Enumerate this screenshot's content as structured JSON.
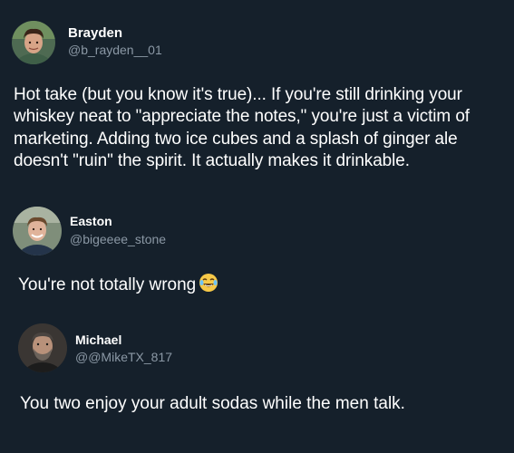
{
  "posts": [
    {
      "display_name": "Brayden",
      "handle": "@b_rayden__01",
      "text": "Hot take (but you know it's true)... If you're still drinking your whiskey neat to \"appreciate the notes,\" you're just a victim of marketing. Adding two ice cubes and a splash of ginger ale doesn't \"ruin\" the spirit. It actually makes it drinkable."
    },
    {
      "display_name": "Easton",
      "handle": "@bigeeee_stone",
      "text": "You're not totally wrong",
      "emoji": "face-with-tears-of-joy-icon"
    },
    {
      "display_name": "Michael",
      "handle": "@@MikeTX_817",
      "text": "You two enjoy your adult sodas while the men talk."
    }
  ],
  "colors": {
    "background": "#15202b",
    "primary_text": "#ffffff",
    "secondary_text": "#8b98a5"
  }
}
